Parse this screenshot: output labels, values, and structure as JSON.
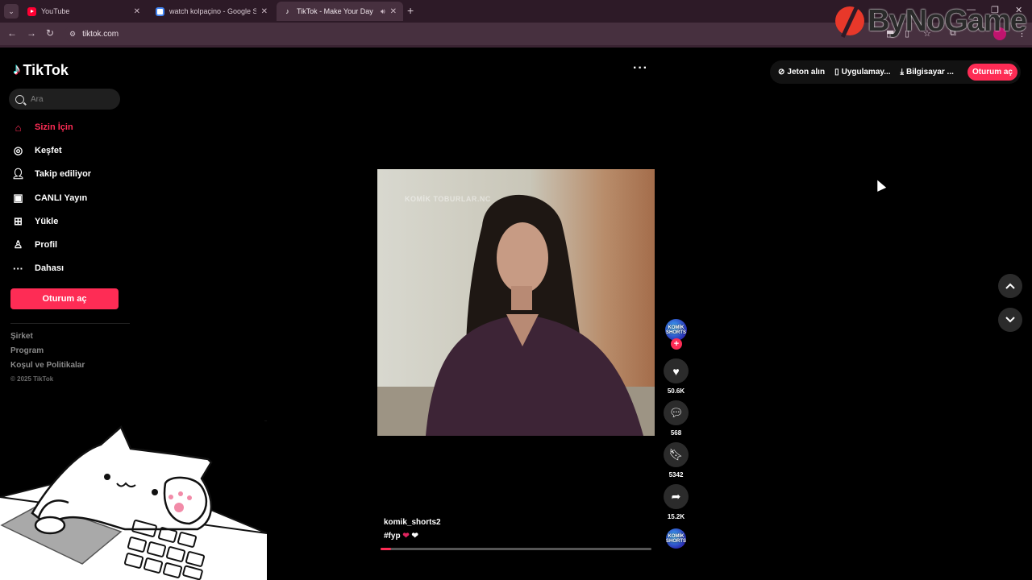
{
  "browser": {
    "tabs": [
      {
        "title": "YouTube",
        "favicon": "youtube-favicon"
      },
      {
        "title": "watch kolpaçino - Google Search",
        "favicon": "google-favicon"
      },
      {
        "title": "TikTok - Make Your Day",
        "favicon": "tiktok-favicon",
        "active": true
      }
    ],
    "url": "tiktok.com",
    "window_controls": [
      "minimize-icon",
      "restore-icon",
      "close-icon"
    ]
  },
  "watermark": {
    "text": "ByNoGame"
  },
  "sidebar": {
    "logo": "TikTok",
    "search_placeholder": "Ara",
    "nav": [
      {
        "label": "Sizin İçin",
        "icon": "home-icon",
        "active": true
      },
      {
        "label": "Keşfet",
        "icon": "compass-icon"
      },
      {
        "label": "Takip ediliyor",
        "icon": "following-icon"
      },
      {
        "label": "CANLI Yayın",
        "icon": "live-icon"
      },
      {
        "label": "Yükle",
        "icon": "upload-icon"
      },
      {
        "label": "Profil",
        "icon": "profile-icon"
      },
      {
        "label": "Dahası",
        "icon": "more-icon"
      }
    ],
    "login_label": "Oturum aç",
    "footer": {
      "links": [
        "Şirket",
        "Program",
        "Koşul ve Politikalar"
      ],
      "copyright": "© 2025 TikTok"
    }
  },
  "topbar": {
    "more_label": "···",
    "coins_label": "Jeton alın",
    "app_label": "Uygulamay...",
    "desktop_label": "Bilgisayar ...",
    "login_label": "Oturum aç"
  },
  "video": {
    "overlay_watermark": "KOMİK TOBURLAR.NC",
    "author": "komik_shorts2",
    "caption": "#fyp",
    "progress": 0.04,
    "avatar_text": "KOMİK SHORTS",
    "likes": "50.6K",
    "comments": "568",
    "saves": "5342",
    "shares": "15.2K"
  },
  "colors": {
    "accent": "#fe2c55",
    "chrome_bg": "#2d1a27",
    "page_bg": "#000000"
  }
}
